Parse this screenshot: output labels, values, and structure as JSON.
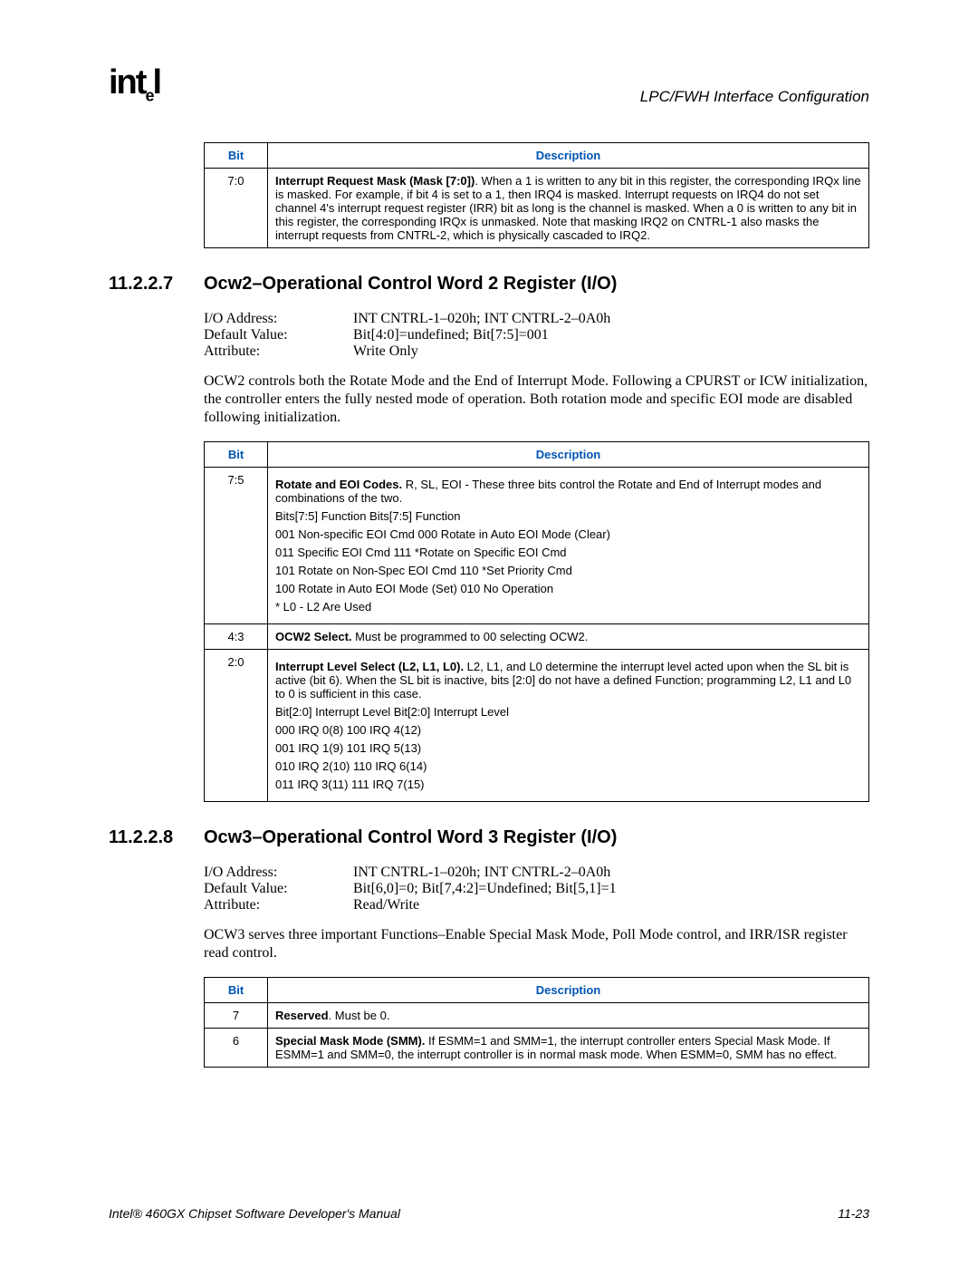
{
  "header": {
    "logo_html": "int<sub>e</sub>l",
    "right": "LPC/FWH Interface Configuration"
  },
  "table1": {
    "h_bit": "Bit",
    "h_desc": "Description",
    "rows": [
      {
        "bit": "7:0",
        "desc_html": "<b>Interrupt Request Mask (Mask [7:0])</b>. When a 1 is written to any bit in this register, the corresponding IRQx line is masked. For example, if bit 4 is set to a 1, then IRQ4 is masked. Interrupt requests on IRQ4 do not set channel 4's interrupt request register (IRR) bit as long is the channel is masked. When a 0 is written to any bit in this register, the corresponding IRQx is unmasked. Note that masking IRQ2 on CNTRL-1 also masks the interrupt requests from CNTRL-2, which is physically cascaded to IRQ2."
      }
    ]
  },
  "sec1": {
    "num": "11.2.2.7",
    "title": "Ocw2–Operational Control Word 2 Register (I/O)",
    "kv": [
      {
        "k": "I/O Address:",
        "v": "INT CNTRL-1–020h; INT CNTRL-2–0A0h"
      },
      {
        "k": "Default Value:",
        "v": "Bit[4:0]=undefined; Bit[7:5]=001"
      },
      {
        "k": "Attribute:",
        "v": "Write Only"
      }
    ],
    "para": "OCW2 controls both the Rotate Mode and the End of Interrupt Mode. Following a CPURST or ICW initialization, the controller enters the fully nested mode of operation. Both rotation mode and specific EOI mode are disabled following initialization."
  },
  "table2": {
    "h_bit": "Bit",
    "h_desc": "Description",
    "rows": [
      {
        "bit": "7:5",
        "desc_html": "<span class=\"line\"><b>Rotate and EOI Codes.</b> R, SL, EOI - These three bits control the Rotate and End of Interrupt modes and combinations of the two.</span><span class=\"line\">Bits[7:5] Function Bits[7:5] Function</span><span class=\"line\">001 Non-specific EOI Cmd 000 Rotate in Auto EOI Mode (Clear)</span><span class=\"line\">011 Specific EOI Cmd 111 *Rotate on Specific EOI Cmd</span><span class=\"line\">101 Rotate on Non-Spec EOI Cmd 110 *Set Priority Cmd</span><span class=\"line\">100 Rotate in Auto EOI Mode (Set) 010 No Operation</span><span class=\"line\">* L0 - L2 Are Used</span>"
      },
      {
        "bit": "4:3",
        "desc_html": "<b>OCW2 Select.</b> Must be programmed to 00 selecting OCW2."
      },
      {
        "bit": "2:0",
        "desc_html": "<span class=\"line\"><b>Interrupt Level Select (L2, L1, L0).</b> L2, L1, and L0 determine the interrupt level acted upon when the SL bit is active (bit 6). When the SL bit is inactive, bits [2:0] do not have a defined Function; programming L2, L1 and L0 to 0 is sufficient in this case.</span><span class=\"line\">Bit[2:0] Interrupt Level Bit[2:0] Interrupt Level</span><span class=\"line\">000 IRQ 0(8) 100 IRQ 4(12)</span><span class=\"line\">001 IRQ 1(9) 101 IRQ 5(13)</span><span class=\"line\">010 IRQ 2(10) 110 IRQ 6(14)</span><span class=\"line\">011 IRQ 3(11) 111 IRQ 7(15)</span>"
      }
    ]
  },
  "sec2": {
    "num": "11.2.2.8",
    "title": "Ocw3–Operational Control Word 3 Register (I/O)",
    "kv": [
      {
        "k": "I/O Address:",
        "v": "INT CNTRL-1–020h; INT CNTRL-2–0A0h"
      },
      {
        "k": "Default Value:",
        "v": "Bit[6,0]=0; Bit[7,4:2]=Undefined; Bit[5,1]=1"
      },
      {
        "k": "Attribute:",
        "v": "Read/Write"
      }
    ],
    "para": "OCW3 serves three important Functions–Enable Special Mask Mode, Poll Mode control, and IRR/ISR register read control."
  },
  "table3": {
    "h_bit": "Bit",
    "h_desc": "Description",
    "rows": [
      {
        "bit": "7",
        "desc_html": "<b>Reserved</b>. Must be 0."
      },
      {
        "bit": "6",
        "desc_html": "<b>Special Mask Mode (SMM).</b> If ESMM=1 and SMM=1, the interrupt controller enters Special Mask Mode. If ESMM=1 and SMM=0, the interrupt controller is in normal mask mode. When ESMM=0, SMM has no effect."
      }
    ]
  },
  "footer": {
    "left": "Intel® 460GX Chipset Software Developer's Manual",
    "right": "11-23"
  }
}
